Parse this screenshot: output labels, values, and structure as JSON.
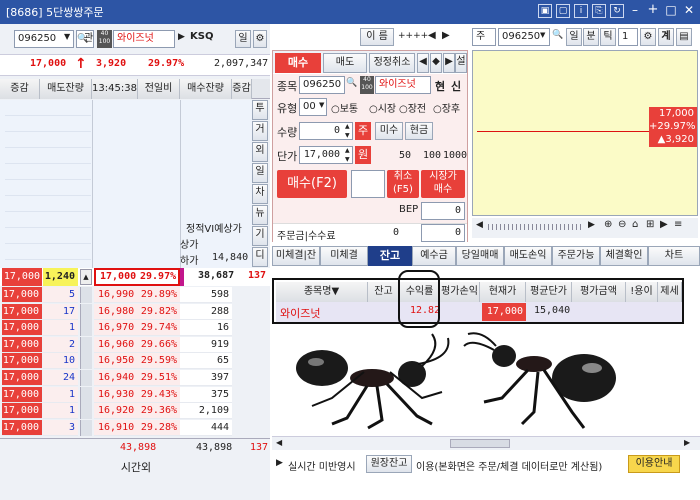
{
  "window": {
    "title": "[8686] 5단쌍쌍주문",
    "titlebar_icons": [
      "pin",
      "restore",
      "info",
      "copy",
      "refresh",
      "minimize",
      "plus",
      "maximize",
      "close"
    ]
  },
  "left": {
    "code": "096250",
    "gwan": "관",
    "mini": "40\n100",
    "stock_name": "와이즈넛",
    "market": "KSQ",
    "il_btn": "일",
    "price": "17,000",
    "arrow": "↑",
    "change": "3,920",
    "rate": "29.97%",
    "volume": "2,097,347",
    "headers": {
      "inc": "증감",
      "sell_rem": "매도잔량",
      "time": "13:45:38",
      "prev": "전일비",
      "buy_rem": "매수잔량",
      "inc2": "증감"
    },
    "side_tabs": [
      "투",
      "거",
      "외",
      "일",
      "차",
      "뉴",
      "기",
      "디"
    ],
    "info": {
      "row1": "정적VI예상가",
      "row2": "상가",
      "row3_label": "하가",
      "row3_val": "14,840"
    },
    "highlight": {
      "left": "17,000",
      "vol": "1,240",
      "price": "17,000",
      "rate": "29.97%",
      "buy": "38,687",
      "inc": "137"
    },
    "levels": [
      {
        "left": "17,000",
        "vol": "5",
        "price": "16,990",
        "rate": "29.89%",
        "buy": "598"
      },
      {
        "left": "17,000",
        "vol": "17",
        "price": "16,980",
        "rate": "29.82%",
        "buy": "288"
      },
      {
        "left": "17,000",
        "vol": "1",
        "price": "16,970",
        "rate": "29.74%",
        "buy": "16"
      },
      {
        "left": "17,000",
        "vol": "2",
        "price": "16,960",
        "rate": "29.66%",
        "buy": "919"
      },
      {
        "left": "17,000",
        "vol": "10",
        "price": "16,950",
        "rate": "29.59%",
        "buy": "65"
      },
      {
        "left": "17,000",
        "vol": "24",
        "price": "16,940",
        "rate": "29.51%",
        "buy": "397"
      },
      {
        "left": "17,000",
        "vol": "1",
        "price": "16,930",
        "rate": "29.43%",
        "buy": "375"
      },
      {
        "left": "17,000",
        "vol": "1",
        "price": "16,920",
        "rate": "29.36%",
        "buy": "2,109"
      },
      {
        "left": "17,000",
        "vol": "3",
        "price": "16,910",
        "rate": "29.28%",
        "buy": "444"
      }
    ],
    "totals": {
      "sell": "43,898",
      "buy": "43,898",
      "inc": "137"
    },
    "after_hours": "시간외"
  },
  "order": {
    "tabs": [
      "매수",
      "매도",
      "정정취소"
    ],
    "tab_extra": "설",
    "code_label": "종목",
    "code": "096250",
    "mini": "40\n100",
    "stock": "와이즈넛",
    "hyun": "현",
    "sin": "신",
    "type_label": "유형",
    "type_value": "00",
    "radios": [
      "보통",
      "시장",
      "장전",
      "장후"
    ],
    "qty_label": "수량",
    "qty": "0",
    "ju": "주",
    "misu": "미수",
    "cash": "현금",
    "price_label": "단가",
    "price": "17,000",
    "won": "원",
    "q50": "50",
    "q100": "100",
    "q1000": "1000",
    "buy_button": "매수(F2)",
    "cancel_button": "취소\n(F5)",
    "market_buy": "시장가\n매수",
    "bep_label": "BEP",
    "bep": "0",
    "order_amt_label": "주문금|수수료",
    "order_amt": "0",
    "fee": "0"
  },
  "top_right": {
    "label": "이 름",
    "stars": "++++",
    "code_mode": "주",
    "code": "096250",
    "il": "일",
    "bun": "분",
    "tik": "틱",
    "one": "1",
    "gear": "⚙",
    "gye": "계",
    "book": "▤",
    "price_tag": "17,000",
    "rate_tag": "+29.97%",
    "chg_tag": "▲3,920"
  },
  "tabs": [
    "미체결|잔",
    "미체결",
    "잔고",
    "예수금",
    "당일매매",
    "매도손익",
    "주문가능",
    "체결확인",
    "차트"
  ],
  "balance": {
    "columns": [
      "종목명▼",
      "잔고",
      "수익률",
      "평가손익",
      "현재가",
      "평균단가",
      "평가금액",
      "!용이자",
      "제세"
    ],
    "row": {
      "name": "와이즈넛",
      "qty": "",
      "yield": "12.82",
      "pnl": "",
      "cur": "17,000",
      "avg": "15,040",
      "amt": "",
      "interest": "",
      "tax": ""
    }
  },
  "bottom": {
    "arrow": "▶",
    "realtime": "실시간 미반영시",
    "wonjang": "원장잔고",
    "note": "이용(본화면은 주문/체결 데이터로만 계산됨)",
    "guide": "이용안내"
  },
  "colors": {
    "titlebar": "#2d55a5",
    "red": "#e01010",
    "blue": "#1a36c8",
    "sell_bg": "#eef3fb",
    "buy_bg": "#fcecec",
    "highlight_yellow": "#f7f35a",
    "chart_bg": "#fbfbc7",
    "left_red": "#e8403a"
  }
}
